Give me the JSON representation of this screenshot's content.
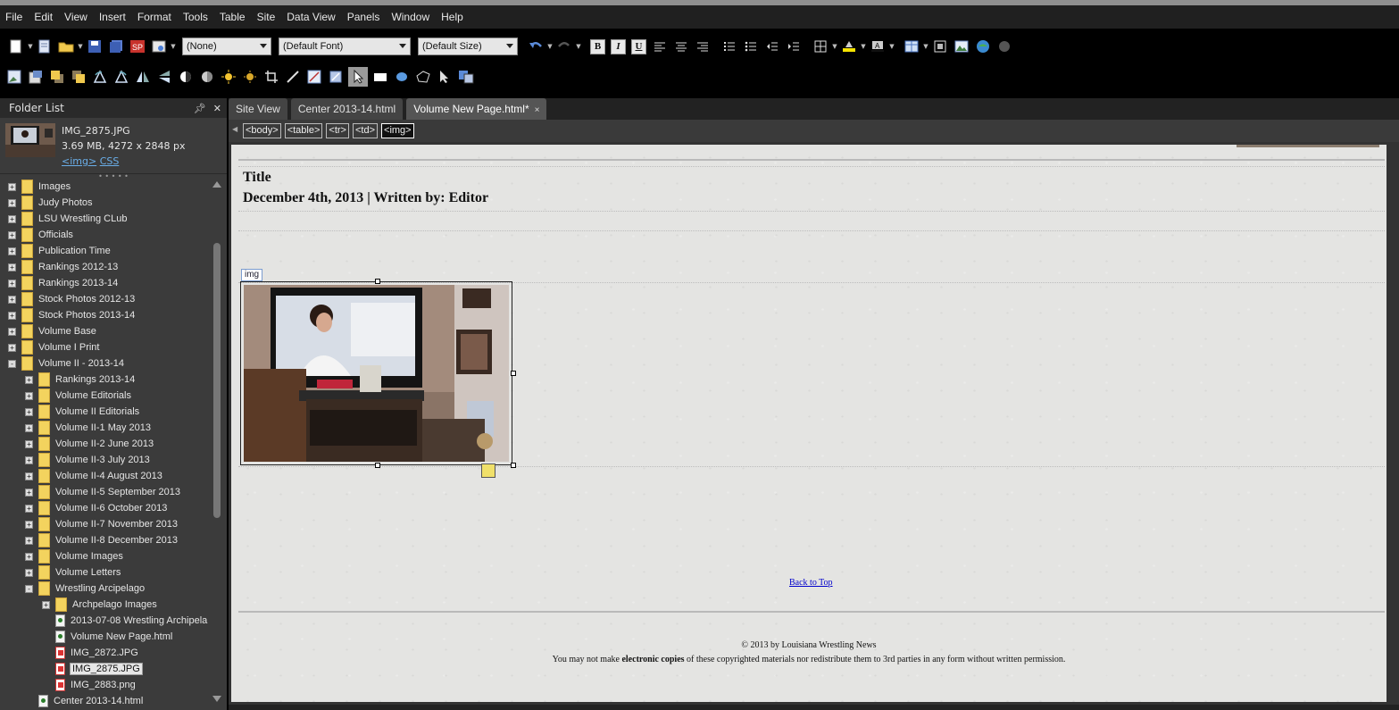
{
  "menu": [
    "File",
    "Edit",
    "View",
    "Insert",
    "Format",
    "Tools",
    "Table",
    "Site",
    "Data View",
    "Panels",
    "Window",
    "Help"
  ],
  "toolbar": {
    "style_select": "(None)",
    "font_select": "(Default Font)",
    "size_select": "(Default Size)",
    "bold": "B",
    "italic": "I",
    "underline": "U"
  },
  "folder_panel": {
    "title": "Folder List",
    "preview": {
      "filename": "IMG_2875.JPG",
      "info": "3.69 MB, 4272 x 2848 px",
      "link_img": "<img>",
      "link_css": "CSS"
    },
    "tree": [
      {
        "label": "Images",
        "level": 0,
        "type": "folder",
        "expander": "+"
      },
      {
        "label": "Judy Photos",
        "level": 0,
        "type": "folder",
        "expander": "+"
      },
      {
        "label": "LSU Wrestling CLub",
        "level": 0,
        "type": "folder",
        "expander": "+"
      },
      {
        "label": "Officials",
        "level": 0,
        "type": "folder",
        "expander": "+"
      },
      {
        "label": "Publication Time",
        "level": 0,
        "type": "folder",
        "expander": "+"
      },
      {
        "label": "Rankings 2012-13",
        "level": 0,
        "type": "folder",
        "expander": "+"
      },
      {
        "label": "Rankings 2013-14",
        "level": 0,
        "type": "folder",
        "expander": "+"
      },
      {
        "label": "Stock Photos 2012-13",
        "level": 0,
        "type": "folder",
        "expander": "+"
      },
      {
        "label": "Stock Photos 2013-14",
        "level": 0,
        "type": "folder",
        "expander": "+"
      },
      {
        "label": "Volume Base",
        "level": 0,
        "type": "folder",
        "expander": "+"
      },
      {
        "label": "Volume I Print",
        "level": 0,
        "type": "folder",
        "expander": "+"
      },
      {
        "label": "Volume II - 2013-14",
        "level": 0,
        "type": "folder",
        "expander": "-"
      },
      {
        "label": "Rankings 2013-14",
        "level": 1,
        "type": "folder",
        "expander": "+"
      },
      {
        "label": "Volume Editorials",
        "level": 1,
        "type": "folder",
        "expander": "+"
      },
      {
        "label": "Volume II Editorials",
        "level": 1,
        "type": "folder",
        "expander": "+"
      },
      {
        "label": "Volume II-1 May 2013",
        "level": 1,
        "type": "folder",
        "expander": "+"
      },
      {
        "label": "Volume II-2 June 2013",
        "level": 1,
        "type": "folder",
        "expander": "+"
      },
      {
        "label": "Volume II-3 July 2013",
        "level": 1,
        "type": "folder",
        "expander": "+"
      },
      {
        "label": "Volume II-4 August 2013",
        "level": 1,
        "type": "folder",
        "expander": "+"
      },
      {
        "label": "Volume II-5 September 2013",
        "level": 1,
        "type": "folder",
        "expander": "+"
      },
      {
        "label": "Volume II-6 October 2013",
        "level": 1,
        "type": "folder",
        "expander": "+"
      },
      {
        "label": "Volume II-7 November 2013",
        "level": 1,
        "type": "folder",
        "expander": "+"
      },
      {
        "label": "Volume II-8 December 2013",
        "level": 1,
        "type": "folder",
        "expander": "+"
      },
      {
        "label": "Volume Images",
        "level": 1,
        "type": "folder",
        "expander": "+"
      },
      {
        "label": "Volume Letters",
        "level": 1,
        "type": "folder",
        "expander": "+"
      },
      {
        "label": "Wrestling Arcipelago",
        "level": 1,
        "type": "folder",
        "expander": "-"
      },
      {
        "label": "Archpelago Images",
        "level": 2,
        "type": "folder",
        "expander": "+"
      },
      {
        "label": "2013-07-08 Wrestling Archipela",
        "level": 2,
        "type": "html",
        "expander": ""
      },
      {
        "label": "Volume New Page.html",
        "level": 2,
        "type": "html",
        "expander": ""
      },
      {
        "label": "IMG_2872.JPG",
        "level": 2,
        "type": "img",
        "expander": ""
      },
      {
        "label": "IMG_2875.JPG",
        "level": 2,
        "type": "img",
        "expander": "",
        "selected": true
      },
      {
        "label": "IMG_2883.png",
        "level": 2,
        "type": "img",
        "expander": ""
      },
      {
        "label": "Center 2013-14.html",
        "level": 1,
        "type": "html",
        "expander": ""
      }
    ]
  },
  "tabs": [
    {
      "label": "Site View",
      "active": false,
      "closable": false
    },
    {
      "label": "Center 2013-14.html",
      "active": false,
      "closable": false
    },
    {
      "label": "Volume New Page.html*",
      "active": true,
      "closable": true
    }
  ],
  "tag_path": [
    "<body>",
    "<table>",
    "<tr>",
    "<td>",
    "<img>"
  ],
  "page": {
    "title": "Title",
    "byline": "December 4th, 2013 | Written by: Editor",
    "img_label": "img",
    "back_to_top": "Back to Top",
    "copyright": "© 2013 by Louisiana Wrestling News",
    "notice_pre": "You may not make ",
    "notice_bold": "electronic copies",
    "notice_post": " of these copyrighted materials nor redistribute them to 3rd parties in any form without written permission."
  },
  "colors": {
    "menubar_bg": "#202020",
    "toolbar_bg": "#000000",
    "panel_bg": "#3b3b3b",
    "canvas_bg": "#e4e4e2",
    "link": "#0000cc"
  }
}
